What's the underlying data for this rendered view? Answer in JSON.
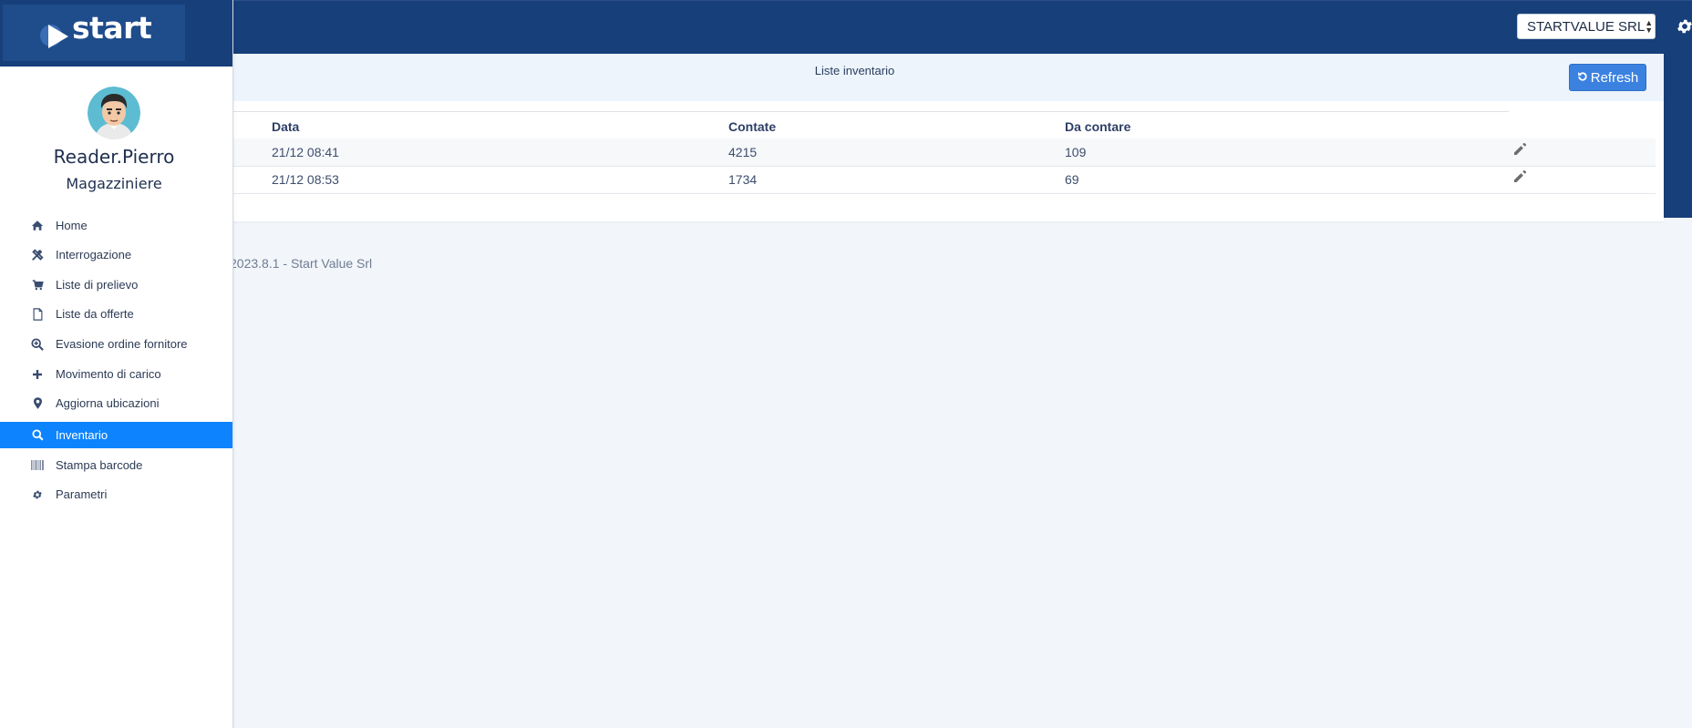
{
  "header": {
    "company_select": "STARTVALUE SRL"
  },
  "logo": {
    "text": "start"
  },
  "user": {
    "name": "Reader.Pierro",
    "role": "Magazziniere"
  },
  "sidebar": {
    "items": [
      {
        "label": "Home",
        "icon": "home-icon",
        "active": false
      },
      {
        "label": "Interrogazione",
        "icon": "tools-icon",
        "active": false
      },
      {
        "label": "Liste di prelievo",
        "icon": "cart-icon",
        "active": false
      },
      {
        "label": "Liste da offerte",
        "icon": "file-icon",
        "active": false
      },
      {
        "label": "Evasione ordine fornitore",
        "icon": "zoom-in-icon",
        "active": false
      },
      {
        "label": "Movimento di carico",
        "icon": "plus-icon",
        "active": false
      },
      {
        "label": "Aggiorna ubicazioni",
        "icon": "map-marker-icon",
        "active": false
      },
      {
        "label": "Inventario",
        "icon": "search-icon",
        "active": true
      },
      {
        "label": "Stampa barcode",
        "icon": "barcode-icon",
        "active": false
      },
      {
        "label": "Parametri",
        "icon": "gear-icon",
        "active": false
      }
    ]
  },
  "panel": {
    "title": "Liste inventario",
    "refresh_label": "Refresh"
  },
  "table": {
    "columns": [
      "Data",
      "Contate",
      "Da contare"
    ],
    "rows": [
      {
        "data": "21/12 08:41",
        "contate": "4215",
        "da_contare": "109"
      },
      {
        "data": "21/12 08:53",
        "contate": "1734",
        "da_contare": "69"
      }
    ]
  },
  "footer": {
    "text": "2023.8.1 - Start Value Srl"
  },
  "colors": {
    "header_bg": "#173f7a",
    "active_menu": "#0d84fe",
    "refresh_btn": "#3b82e0",
    "page_bg": "#f2f6fb"
  }
}
